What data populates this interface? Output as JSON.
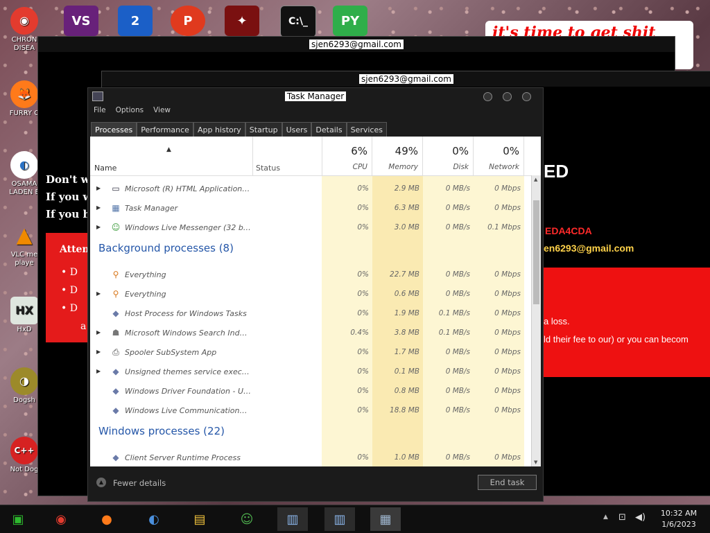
{
  "desktop": {
    "icons_left": [
      {
        "label": "CHRON DISEA",
        "icon": "chrome-icon",
        "color": "#e33b2e"
      },
      {
        "label": "FURRY C",
        "icon": "firefox-icon",
        "color": "#ff7a1a"
      },
      {
        "label": "OSAMA LADEN E",
        "icon": "obama-logo-icon",
        "color": "#2a72c4"
      },
      {
        "label": "VLC me playe",
        "icon": "vlc-cone-icon",
        "color": "#f08a00"
      },
      {
        "label": "HxD",
        "icon": "hxd-icon",
        "color": "#3b3b3b"
      },
      {
        "label": "Dogsh",
        "icon": "dogshit-icon",
        "color": "#9c8a2a"
      },
      {
        "label": "Not Dog",
        "icon": "devcpp-icon",
        "color": "#d62222"
      }
    ],
    "icons_top": [
      "visual-studio-icon",
      "superhero-2-icon",
      "pizza-p-icon",
      "crow-icon",
      "cmd-icon",
      "pycharm-icon"
    ],
    "graffiti_text": "it's time to get shit"
  },
  "ransom_window_back": {
    "title": "sjen6293@gmail.com"
  },
  "ransom_window_front": {
    "title": "sjen6293@gmail.com",
    "lines_left": [
      "Don't wo",
      "If you w",
      "If you ha"
    ],
    "attention": "Atten",
    "bullets": [
      "D",
      "D",
      "D"
    ],
    "bullet_tail": "a",
    "right_heading": "ED",
    "right_code": "EDA4CDA",
    "right_email": "en6293@gmail.com",
    "right_red_line1": "a loss.",
    "right_red_line2": "ld their fee to our) or you can becom"
  },
  "task_manager": {
    "title": "Task Manager",
    "menu": [
      "File",
      "Options",
      "View"
    ],
    "tabs": [
      "Processes",
      "Performance",
      "App history",
      "Startup",
      "Users",
      "Details",
      "Services"
    ],
    "columns": {
      "name": "Name",
      "status": "Status",
      "cpu": {
        "pct": "6%",
        "label": "CPU"
      },
      "memory": {
        "pct": "49%",
        "label": "Memory"
      },
      "disk": {
        "pct": "0%",
        "label": "Disk"
      },
      "network": {
        "pct": "0%",
        "label": "Network"
      }
    },
    "apps_rows": [
      {
        "name": "Microsoft (R) HTML Application ho...",
        "cpu": "0%",
        "mem": "2.9 MB",
        "disk": "0 MB/s",
        "net": "0 Mbps",
        "expand": true,
        "icon": "window-icon"
      },
      {
        "name": "Task Manager",
        "cpu": "0%",
        "mem": "6.3 MB",
        "disk": "0 MB/s",
        "net": "0 Mbps",
        "expand": true,
        "icon": "task-manager-icon"
      },
      {
        "name": "Windows Live Messenger (32 bit)",
        "cpu": "0%",
        "mem": "3.0 MB",
        "disk": "0 MB/s",
        "net": "0.1 Mbps",
        "expand": true,
        "icon": "messenger-icon"
      }
    ],
    "background_header": "Background processes (8)",
    "background_rows": [
      {
        "name": "Everything",
        "cpu": "0%",
        "mem": "22.7 MB",
        "disk": "0 MB/s",
        "net": "0 Mbps",
        "expand": false,
        "icon": "magnifier-icon"
      },
      {
        "name": "Everything",
        "cpu": "0%",
        "mem": "0.6 MB",
        "disk": "0 MB/s",
        "net": "0 Mbps",
        "expand": true,
        "icon": "magnifier-icon"
      },
      {
        "name": "Host Process for Windows Tasks",
        "cpu": "0%",
        "mem": "1.9 MB",
        "disk": "0.1 MB/s",
        "net": "0 Mbps",
        "expand": false,
        "icon": "diamond-icon"
      },
      {
        "name": "Microsoft Windows Search Indexer",
        "cpu": "0.4%",
        "mem": "3.8 MB",
        "disk": "0.1 MB/s",
        "net": "0 Mbps",
        "expand": true,
        "icon": "person-icon"
      },
      {
        "name": "Spooler SubSystem App",
        "cpu": "0%",
        "mem": "1.7 MB",
        "disk": "0 MB/s",
        "net": "0 Mbps",
        "expand": true,
        "icon": "printer-icon"
      },
      {
        "name": "Unsigned themes service executa...",
        "cpu": "0%",
        "mem": "0.1 MB",
        "disk": "0 MB/s",
        "net": "0 Mbps",
        "expand": true,
        "icon": "diamond-icon"
      },
      {
        "name": "Windows Driver Foundation - User...",
        "cpu": "0%",
        "mem": "0.8 MB",
        "disk": "0 MB/s",
        "net": "0 Mbps",
        "expand": false,
        "icon": "diamond-icon"
      },
      {
        "name": "Windows Live Communications Pl...",
        "cpu": "0%",
        "mem": "18.8 MB",
        "disk": "0 MB/s",
        "net": "0 Mbps",
        "expand": false,
        "icon": "diamond-icon"
      }
    ],
    "windows_header": "Windows processes (22)",
    "windows_rows": [
      {
        "name": "Client Server Runtime Process",
        "cpu": "0%",
        "mem": "1.0 MB",
        "disk": "0 MB/s",
        "net": "0 Mbps",
        "expand": false,
        "icon": "diamond-icon"
      }
    ],
    "fewer_details": "Fewer details",
    "end_task": "End task"
  },
  "taskbar": {
    "apps": [
      "photos-icon",
      "chrome-icon",
      "firefox-icon",
      "obama-logo-icon",
      "file-explorer-icon",
      "messenger-icon",
      "hta-window-icon",
      "hta-window-icon",
      "task-manager-icon"
    ],
    "time": "10:32 AM",
    "date": "1/6/2023"
  },
  "colors": {
    "cpu_highlight": "#fdf3c6",
    "mem_highlight": "#f8e7a8",
    "section_blue": "#2456a8",
    "ransom_red": "#ff0000"
  }
}
